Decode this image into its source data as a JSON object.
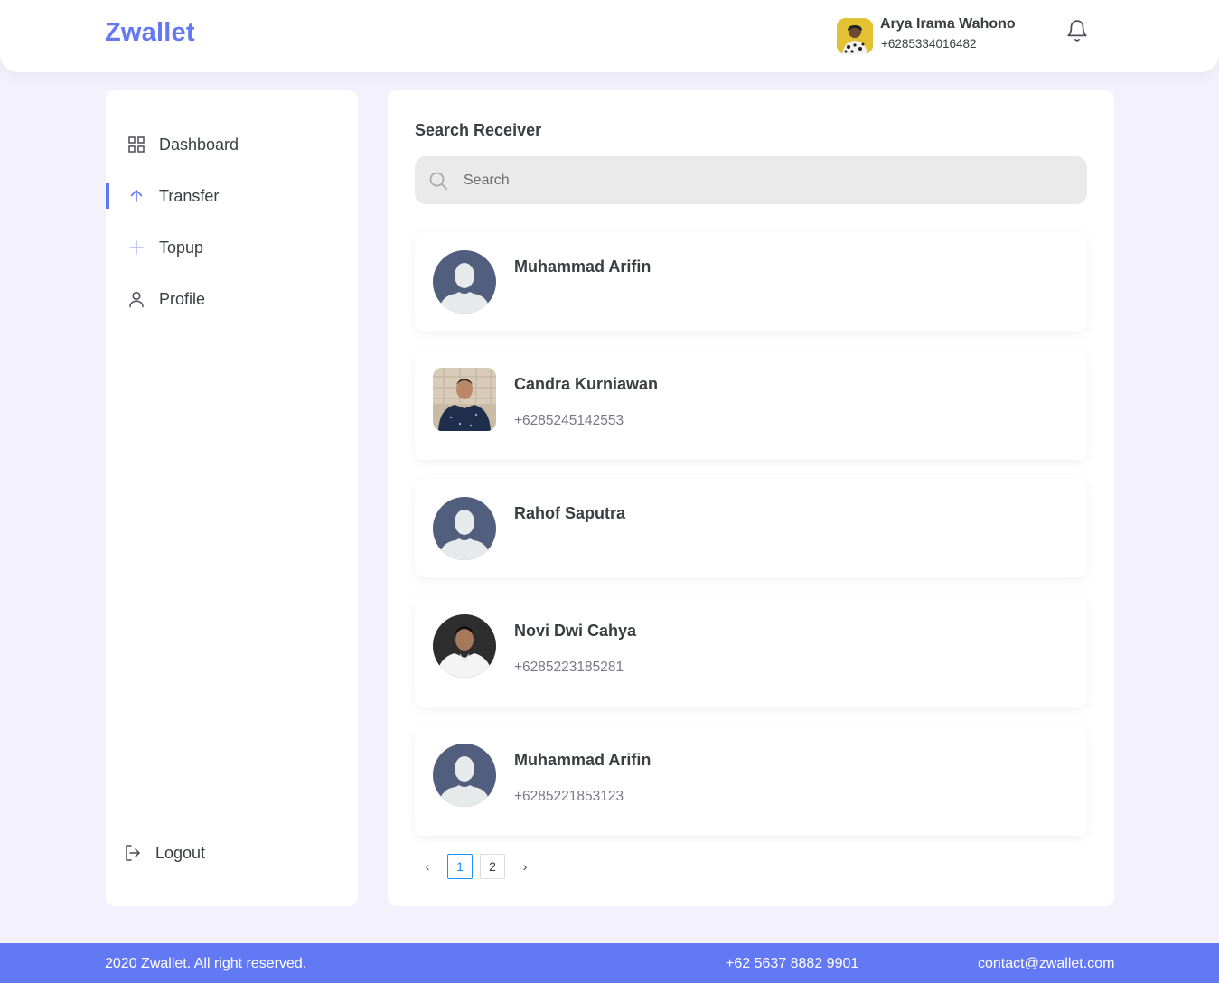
{
  "brand": "Zwallet",
  "user": {
    "name": "Arya Irama Wahono",
    "phone": "+6285334016482"
  },
  "sidebar": {
    "items": [
      {
        "label": "Dashboard",
        "icon": "grid-icon"
      },
      {
        "label": "Transfer",
        "icon": "arrow-up-icon",
        "active": true
      },
      {
        "label": "Topup",
        "icon": "plus-icon"
      },
      {
        "label": "Profile",
        "icon": "user-icon"
      }
    ],
    "logout": {
      "label": "Logout",
      "icon": "logout-icon"
    }
  },
  "main": {
    "title": "Search Receiver",
    "search": {
      "placeholder": "Search",
      "value": ""
    },
    "receivers": [
      {
        "name": "Muhammad Arifin",
        "phone": "",
        "avatar": "default-avatar"
      },
      {
        "name": "Candra Kurniawan",
        "phone": "+6285245142553",
        "avatar": "photo"
      },
      {
        "name": "Rahof Saputra",
        "phone": "",
        "avatar": "default-avatar"
      },
      {
        "name": "Novi Dwi Cahya",
        "phone": "+6285223185281",
        "avatar": "photo"
      },
      {
        "name": "Muhammad Arifin",
        "phone": "+6285221853123",
        "avatar": "default-avatar"
      }
    ],
    "pagination": {
      "prev": "‹",
      "pages": [
        "1",
        "2"
      ],
      "current": "1",
      "next": "›"
    }
  },
  "footer": {
    "copyright": "2020 Zwallet. All right reserved.",
    "phone": "+62 5637 8882 9901",
    "email": "contact@zwallet.com"
  },
  "colors": {
    "accent": "#6379f4",
    "background": "#f3f1fc",
    "text": "#3a3d42",
    "muted": "#7a7886"
  }
}
